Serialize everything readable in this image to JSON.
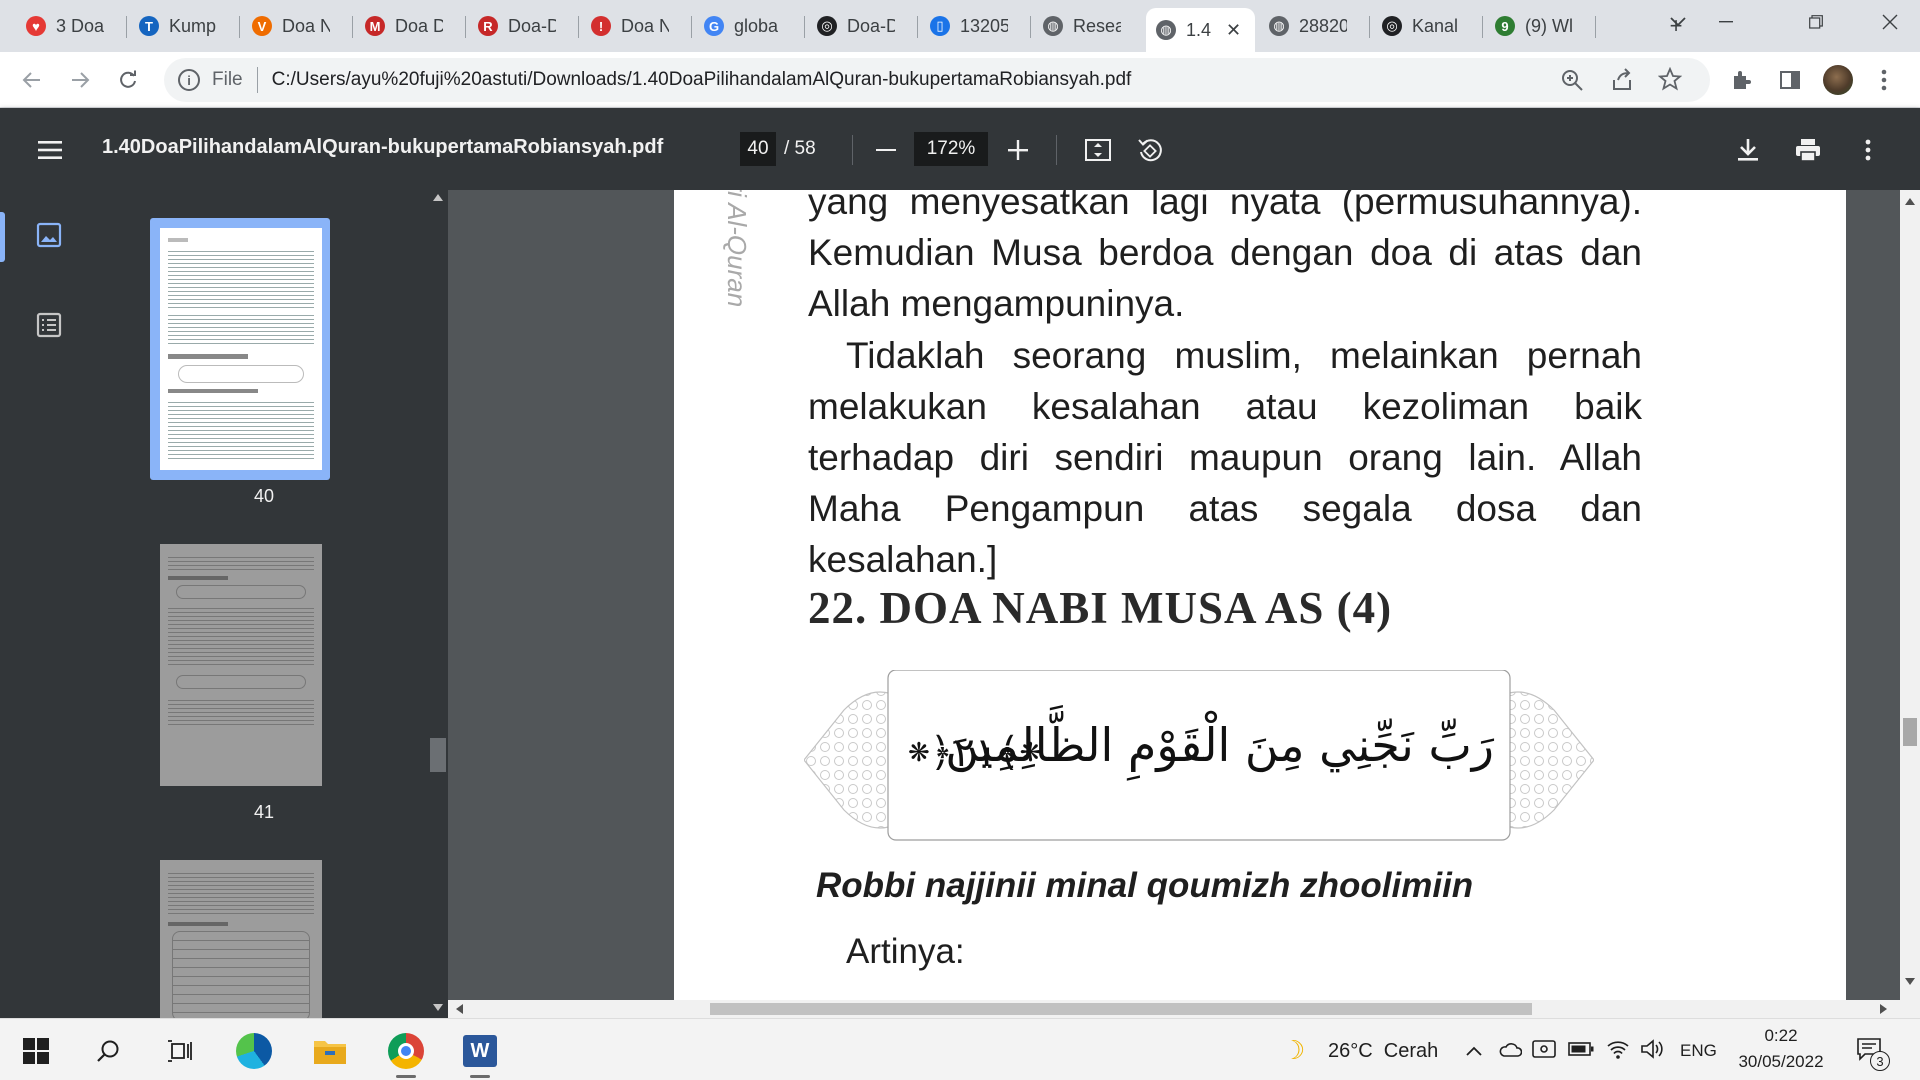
{
  "browser": {
    "tabs": [
      {
        "label": "3 Doa",
        "color": "#e53935",
        "glyph": "♥"
      },
      {
        "label": "Kump",
        "color": "#1565c0",
        "glyph": "T"
      },
      {
        "label": "Doa N",
        "color": "#ef6c00",
        "glyph": "V"
      },
      {
        "label": "Doa D",
        "color": "#c62828",
        "glyph": "M"
      },
      {
        "label": "Doa-D",
        "color": "#c62828",
        "glyph": "R"
      },
      {
        "label": "Doa N",
        "color": "#d32f2f",
        "glyph": "!"
      },
      {
        "label": "globa",
        "color": "#4285f4",
        "glyph": "G"
      },
      {
        "label": "Doa-D",
        "color": "#202124",
        "glyph": "◎"
      },
      {
        "label": "13205",
        "color": "#1a73e8",
        "glyph": "▯"
      },
      {
        "label": "Resea",
        "color": "#5f6368",
        "glyph": "◍"
      },
      {
        "label": "1.4",
        "color": "#5f6368",
        "glyph": "◍"
      },
      {
        "label": "28820",
        "color": "#5f6368",
        "glyph": "◍"
      },
      {
        "label": "Kanal",
        "color": "#202124",
        "glyph": "◎"
      },
      {
        "label": "(9) Wl",
        "color": "#2e7d32",
        "glyph": "9"
      }
    ],
    "active_tab_index": 10,
    "new_tab_symbol": "+",
    "url_scheme": "File",
    "url": "C:/Users/ayu%20fuji%20astuti/Downloads/1.40DoaPilihandalamAlQuran-bukupertamaRobiansyah.pdf"
  },
  "pdf": {
    "filename": "1.40DoaPilihandalamAlQuran-bukupertamaRobiansyah.pdf",
    "current_page": "40",
    "total_pages": "/ 58",
    "zoom": "172%",
    "thumbnails": [
      {
        "number": "40",
        "selected": true
      },
      {
        "number": "41",
        "selected": false
      },
      {
        "number": "",
        "selected": false
      }
    ],
    "page": {
      "side_header": "ari Al-Quran",
      "para1": "yang menyesatkan lagi nyata (permusuhannya). Kemudian Musa berdoa dengan doa di atas dan Allah mengampuninya.",
      "para2": "Tidaklah seorang muslim, melainkan pernah melakukan kesalahan atau kezoliman baik terhadap diri sendiri maupun orang lain. Allah Maha Pengampun atas segala dosa dan kesalahan.]",
      "heading": "22. DOA NABI MUSA AS (4)",
      "arabic": "رَبِّ نَجِّنِي مِنَ الْقَوْمِ الظَّالِمِينَ",
      "verse_number": "٢١",
      "transliteration": "Robbi najjinii minal qoumizh zhoolimiin",
      "artinya": "Artinya:"
    }
  },
  "taskbar": {
    "weather": "26°C  Cerah",
    "language": "ENG",
    "time": "0:22",
    "date": "30/05/2022",
    "notifications": "3"
  }
}
